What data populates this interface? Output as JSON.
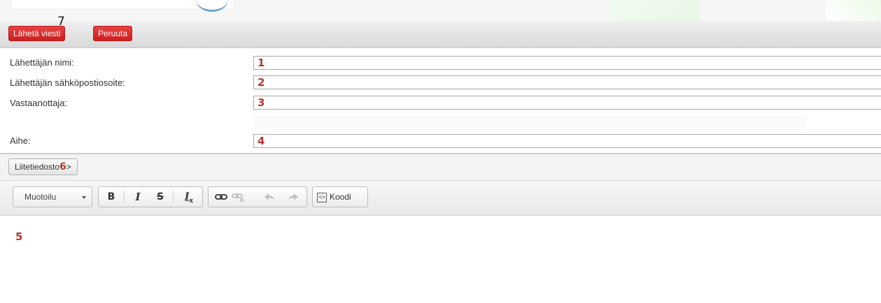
{
  "header": {
    "send_button": "Lähetä viesti",
    "cancel_button": "Peruuta",
    "send_marker": "7"
  },
  "form": {
    "sender_name": {
      "label": "Lähettäjän nimi:",
      "marker": "1",
      "value": ""
    },
    "sender_email": {
      "label": "Lähettäjän sähköpostiosoite:",
      "marker": "2",
      "value": ""
    },
    "recipient": {
      "label": "Vastaanottaja:",
      "marker": "3",
      "value": ""
    },
    "subject": {
      "label": "Aihe:",
      "marker": "4",
      "value": ""
    }
  },
  "attachment": {
    "button_label": "Liitetiedosto",
    "marker": "6",
    "suffix": ">"
  },
  "toolbar": {
    "format_select": "Muotoilu",
    "bold": "B",
    "italic": "I",
    "strike": "S",
    "remove_format": "I",
    "remove_format_sub": "x",
    "code_label": "Koodi",
    "icons": [
      "bold-icon",
      "italic-icon",
      "strikethrough-icon",
      "remove-format-icon",
      "link-icon",
      "unlink-icon",
      "undo-icon",
      "redo-icon",
      "source-code-icon"
    ]
  },
  "editor": {
    "marker": "5",
    "content": ""
  },
  "colors": {
    "accent_red": "#d62a2a",
    "marker_red": "#b03a2e",
    "toolbar_bg": "#ececec"
  }
}
